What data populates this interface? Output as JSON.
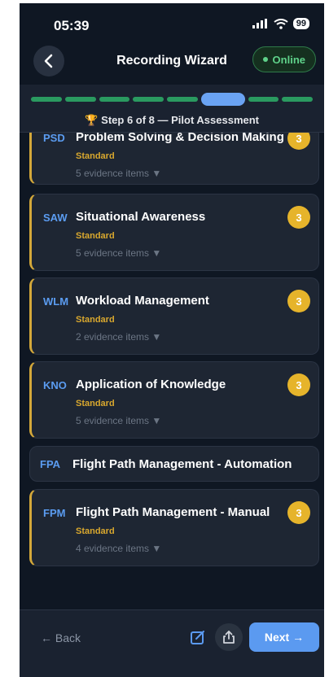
{
  "status_bar": {
    "time": "05:39",
    "signal_icon": "signal-icon",
    "wifi_icon": "wifi-icon",
    "battery": "99"
  },
  "header": {
    "back_icon": "chevron-left-icon",
    "title": "Recording Wizard",
    "status": "Online"
  },
  "progress": {
    "current_step": 6,
    "total_steps": 8,
    "label": "Step 6 of 8 — Pilot Assessment",
    "icon": "trophy-icon"
  },
  "competencies": [
    {
      "code": "PSD",
      "name": "Problem Solving & Decision Making",
      "level": "Standard",
      "evidence": "5 evidence items ▼",
      "score": "3"
    },
    {
      "code": "SAW",
      "name": "Situational Awareness",
      "level": "Standard",
      "evidence": "5 evidence items ▼",
      "score": "3"
    },
    {
      "code": "WLM",
      "name": "Workload Management",
      "level": "Standard",
      "evidence": "2 evidence items ▼",
      "score": "3"
    },
    {
      "code": "KNO",
      "name": "Application of Knowledge",
      "level": "Standard",
      "evidence": "5 evidence items ▼",
      "score": "3"
    },
    {
      "code": "FPA",
      "name": "Flight Path Management - Automation"
    },
    {
      "code": "FPM",
      "name": "Flight Path Management - Manual",
      "level": "Standard",
      "evidence": "4 evidence items ▼",
      "score": "3"
    }
  ],
  "footer": {
    "back_label": "← Back",
    "edit_icon": "edit-icon",
    "share_icon": "share-icon",
    "next_label": "Next →"
  },
  "colors": {
    "background": "#0f1723",
    "card": "#1e2633",
    "accent_gold": "#d4a83a",
    "accent_blue": "#5b9af0",
    "online_green": "#5fd28a",
    "progress_done": "#2a9a60"
  }
}
